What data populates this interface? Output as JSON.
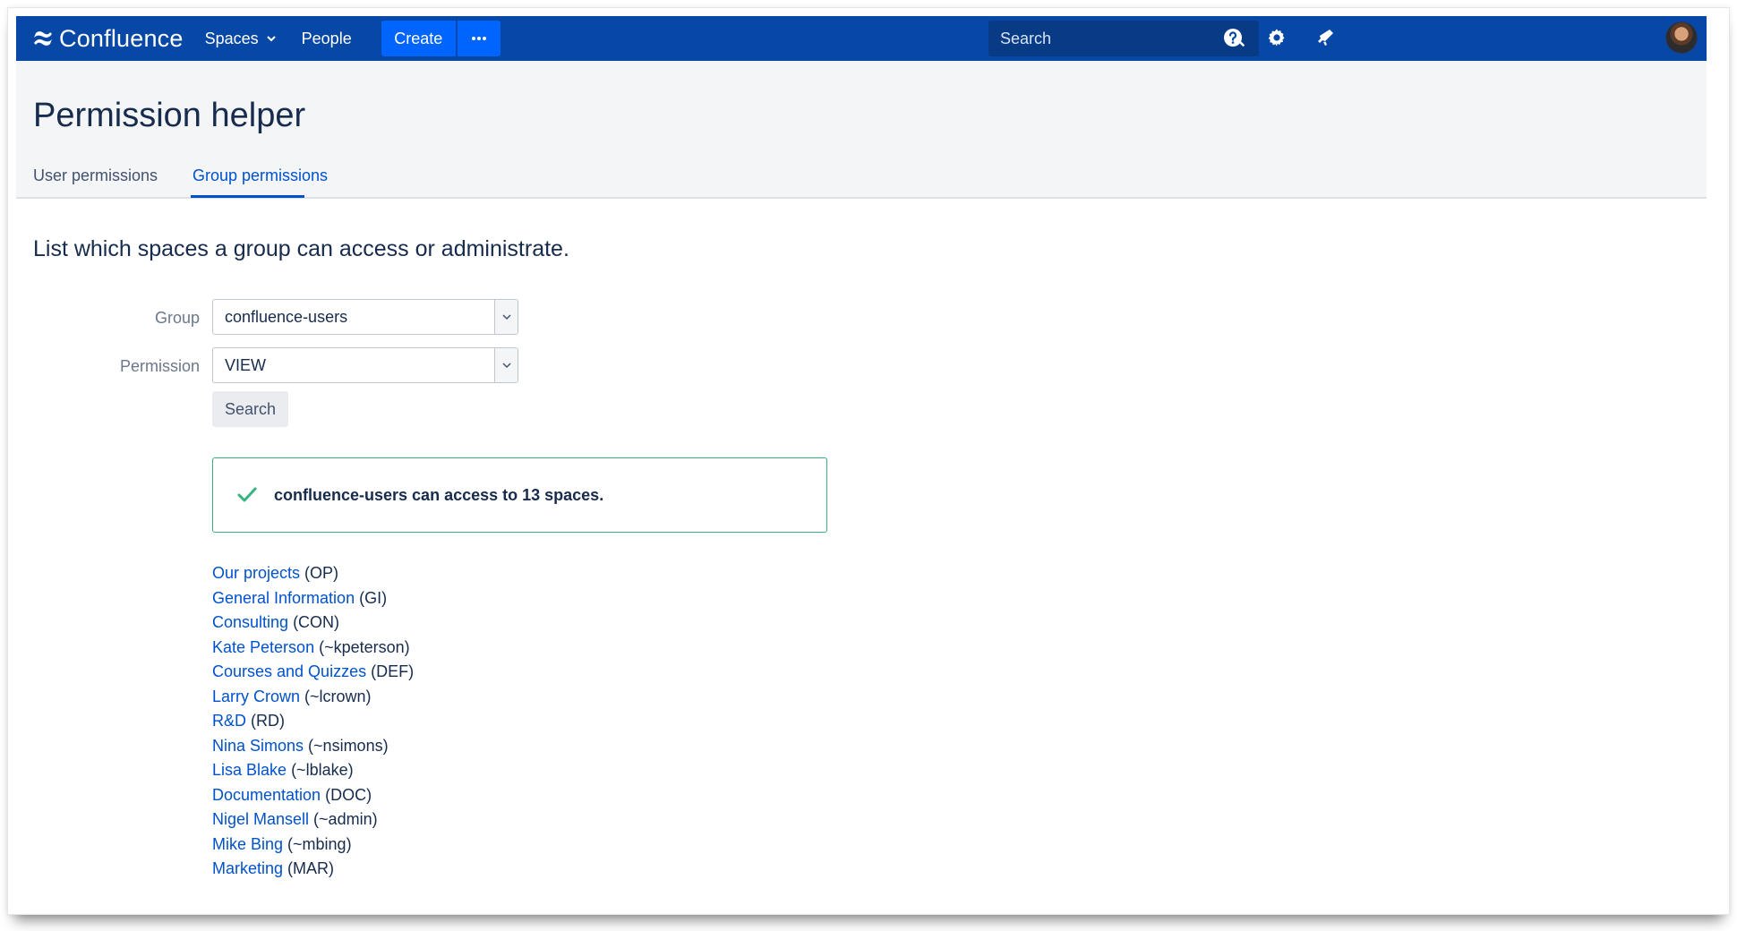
{
  "app": {
    "brand": "Confluence"
  },
  "nav": {
    "spaces_label": "Spaces",
    "people_label": "People",
    "create_label": "Create",
    "more_label": "•••",
    "search_placeholder": "Search"
  },
  "page": {
    "title": "Permission helper",
    "tabs": [
      {
        "label": "User permissions",
        "active": false
      },
      {
        "label": "Group permissions",
        "active": true
      }
    ],
    "intro": "List which spaces a group can access or administrate."
  },
  "form": {
    "group_label": "Group",
    "group_value": "confluence-users",
    "permission_label": "Permission",
    "permission_value": "VIEW",
    "search_button": "Search"
  },
  "result": {
    "message": "confluence-users can access to 13 spaces."
  },
  "spaces": [
    {
      "name": "Our projects",
      "key": " (OP)"
    },
    {
      "name": "General Information",
      "key": " (GI)"
    },
    {
      "name": "Consulting",
      "key": " (CON)"
    },
    {
      "name": "Kate Peterson",
      "key": " (~kpeterson)"
    },
    {
      "name": "Courses and Quizzes",
      "key": " (DEF)"
    },
    {
      "name": "Larry Crown",
      "key": " (~lcrown)"
    },
    {
      "name": "R&D",
      "key": " (RD)"
    },
    {
      "name": "Nina Simons",
      "key": " (~nsimons)"
    },
    {
      "name": "Lisa Blake",
      "key": " (~lblake)"
    },
    {
      "name": "Documentation",
      "key": " (DOC)"
    },
    {
      "name": "Nigel Mansell",
      "key": " (~admin)"
    },
    {
      "name": "Mike Bing",
      "key": " (~mbing)"
    },
    {
      "name": "Marketing",
      "key": " (MAR)"
    }
  ],
  "colors": {
    "nav_bg": "#0747a6",
    "accent": "#0052cc",
    "create_bg": "#0065ff",
    "success": "#36b37e"
  },
  "icons": {
    "logo": "confluence-logo-icon",
    "help": "help-icon",
    "settings": "gear-icon",
    "notifications": "megaphone-icon",
    "search": "search-icon",
    "success": "check-icon"
  }
}
